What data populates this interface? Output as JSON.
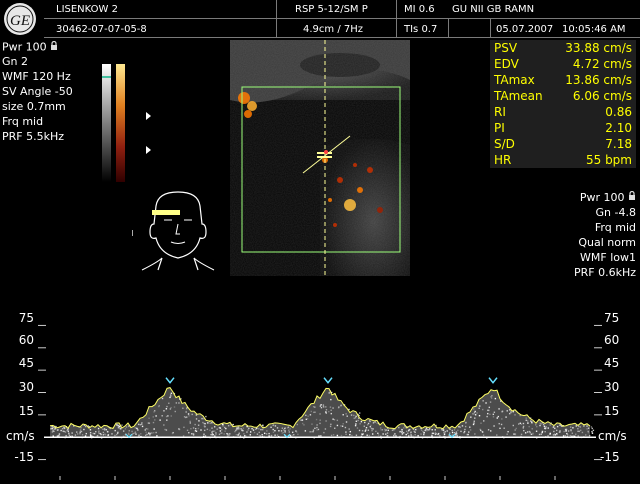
{
  "header": {
    "patient": "LISENKOW 2",
    "exam_id": "30462-07-07-05-8",
    "probe": "RSP 5-12/SM P",
    "depth_freq": "4.9cm / 7Hz",
    "mi": "MI  0.6",
    "tis": "TIs  0.7",
    "institution": "GU NII GB RAMN",
    "date": "05.07.2007",
    "time": "10:05:46 AM",
    "logo": "GE"
  },
  "left_params": [
    "Pwr 100",
    "Gn  2",
    "WMF 120 Hz",
    "SV Angle -50",
    "size  0.7mm",
    "Frq mid",
    "PRF  5.5kHz"
  ],
  "image_logo": "GE",
  "measurements": [
    {
      "label": "PSV",
      "value": "33.88 cm/s"
    },
    {
      "label": "EDV",
      "value": "4.72 cm/s"
    },
    {
      "label": "TAmax",
      "value": "13.86 cm/s"
    },
    {
      "label": "TAmean",
      "value": "6.06 cm/s"
    },
    {
      "label": "RI",
      "value": "0.86"
    },
    {
      "label": "PI",
      "value": "2.10"
    },
    {
      "label": "S/D",
      "value": "7.18"
    },
    {
      "label": "HR",
      "value": "55 bpm"
    }
  ],
  "right_params": [
    "Pwr 100",
    "Gn -4.8",
    "Frq mid",
    "Qual norm",
    "WMF low1",
    "PRF  0.6kHz"
  ],
  "doppler": {
    "unit": "cm/s",
    "ticks_left": [
      "75",
      "60",
      "45",
      "30",
      "15",
      "-15"
    ],
    "ticks_right": [
      "75",
      "60",
      "45",
      "30",
      "15",
      "-15"
    ],
    "tick_values": [
      75,
      60,
      45,
      30,
      15,
      -15
    ],
    "range": [
      -22,
      82
    ],
    "envelope_peaks_cm_s": [
      33.88,
      33.88,
      33.88
    ],
    "baseline_cm_s": 4.72
  },
  "colors": {
    "trace": "#ffff66",
    "marker": "#66e0ff",
    "roi": "#9cff7a",
    "cursor": "#ffff99",
    "measure_text": "#ffff00"
  }
}
